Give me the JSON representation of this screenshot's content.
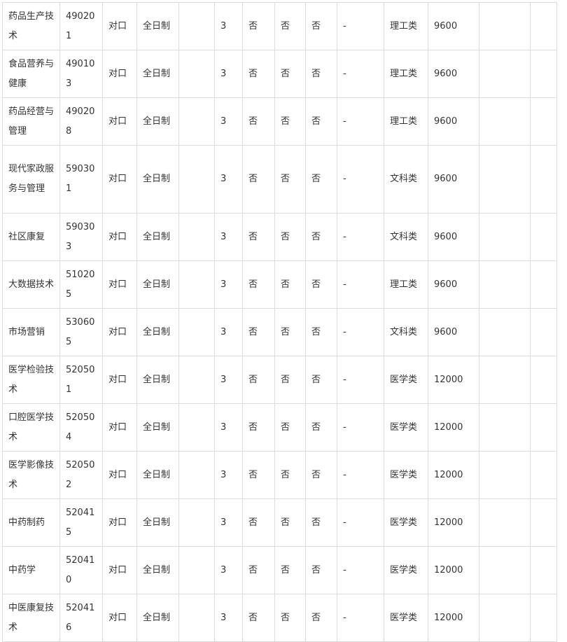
{
  "rows": [
    {
      "name": "药品生产技术",
      "code": "490201",
      "type": "对口",
      "mode": "全日制",
      "years": "3",
      "c1": "否",
      "c2": "否",
      "c3": "否",
      "dash": "-",
      "category": "理工类",
      "fee": "9600",
      "extra1": "",
      "extra2": ""
    },
    {
      "name": "食品营养与健康",
      "code": "490103",
      "type": "对口",
      "mode": "全日制",
      "years": "3",
      "c1": "否",
      "c2": "否",
      "c3": "否",
      "dash": "-",
      "category": "理工类",
      "fee": "9600",
      "extra1": "",
      "extra2": ""
    },
    {
      "name": "药品经营与管理",
      "code": "490208",
      "type": "对口",
      "mode": "全日制",
      "years": "3",
      "c1": "否",
      "c2": "否",
      "c3": "否",
      "dash": "-",
      "category": "理工类",
      "fee": "9600",
      "extra1": "",
      "extra2": ""
    },
    {
      "name": "现代家政服务与管理",
      "code": "590301",
      "type": "对口",
      "mode": "全日制",
      "years": "3",
      "c1": "否",
      "c2": "否",
      "c3": "否",
      "dash": "-",
      "category": "文科类",
      "fee": "9600",
      "extra1": "",
      "extra2": ""
    },
    {
      "name": "社区康复",
      "code": "590303",
      "type": "对口",
      "mode": "全日制",
      "years": "3",
      "c1": "否",
      "c2": "否",
      "c3": "否",
      "dash": "-",
      "category": "文科类",
      "fee": "9600",
      "extra1": "",
      "extra2": ""
    },
    {
      "name": "大数据技术",
      "code": "510205",
      "type": "对口",
      "mode": "全日制",
      "years": "3",
      "c1": "否",
      "c2": "否",
      "c3": "否",
      "dash": "-",
      "category": "理工类",
      "fee": "9600",
      "extra1": "",
      "extra2": ""
    },
    {
      "name": "市场营销",
      "code": "530605",
      "type": "对口",
      "mode": "全日制",
      "years": "3",
      "c1": "否",
      "c2": "否",
      "c3": "否",
      "dash": "-",
      "category": "文科类",
      "fee": "9600",
      "extra1": "",
      "extra2": ""
    },
    {
      "name": "医学检验技术",
      "code": "520501",
      "type": "对口",
      "mode": "全日制",
      "years": "3",
      "c1": "否",
      "c2": "否",
      "c3": "否",
      "dash": "-",
      "category": "医学类",
      "fee": "12000",
      "extra1": "",
      "extra2": ""
    },
    {
      "name": "口腔医学技术",
      "code": "520504",
      "type": "对口",
      "mode": "全日制",
      "years": "3",
      "c1": "否",
      "c2": "否",
      "c3": "否",
      "dash": "-",
      "category": "医学类",
      "fee": "12000",
      "extra1": "",
      "extra2": ""
    },
    {
      "name": "医学影像技术",
      "code": "520502",
      "type": "对口",
      "mode": "全日制",
      "years": "3",
      "c1": "否",
      "c2": "否",
      "c3": "否",
      "dash": "-",
      "category": "医学类",
      "fee": "12000",
      "extra1": "",
      "extra2": ""
    },
    {
      "name": "中药制药",
      "code": "520415",
      "type": "对口",
      "mode": "全日制",
      "years": "3",
      "c1": "否",
      "c2": "否",
      "c3": "否",
      "dash": "-",
      "category": "医学类",
      "fee": "12000",
      "extra1": "",
      "extra2": ""
    },
    {
      "name": "中药学",
      "code": "520410",
      "type": "对口",
      "mode": "全日制",
      "years": "3",
      "c1": "否",
      "c2": "否",
      "c3": "否",
      "dash": "-",
      "category": "医学类",
      "fee": "12000",
      "extra1": "",
      "extra2": ""
    },
    {
      "name": "中医康复技术",
      "code": "520416",
      "type": "对口",
      "mode": "全日制",
      "years": "3",
      "c1": "否",
      "c2": "否",
      "c3": "否",
      "dash": "-",
      "category": "医学类",
      "fee": "12000",
      "extra1": "",
      "extra2": ""
    }
  ]
}
